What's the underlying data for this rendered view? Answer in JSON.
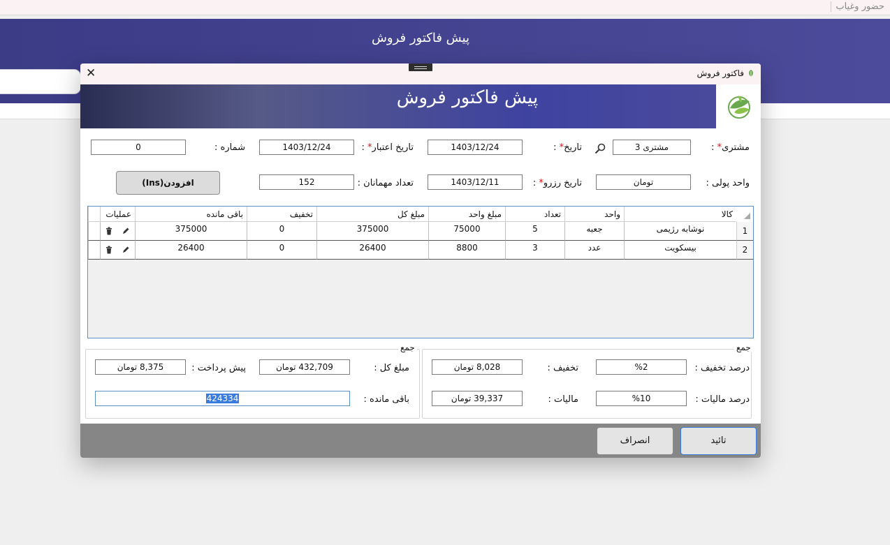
{
  "background": {
    "top_link": "حضور وغیاب",
    "header_title": "پیش فاکتور فروش"
  },
  "dialog": {
    "window_title": "فاکتور فروش",
    "close_glyph": "✕",
    "banner_title": "پیش فاکتور فروش",
    "form": {
      "customer_label": "مشتری",
      "customer_value": "مشتری 3",
      "date_label": "تاریخ",
      "date_value": "1403/12/24",
      "validity_label": "تاریخ اعتبار",
      "validity_value": "1403/12/24",
      "number_label": "شماره :",
      "number_value": "0",
      "currency_label": "واحد پولی :",
      "currency_value": "تومان",
      "reserve_label": "تاریخ رزرو",
      "reserve_value": "1403/12/11",
      "guests_label": "تعداد مهمانان :",
      "guests_value": "152",
      "required_mark": "*",
      "colon": " :",
      "add_button": "افزودن",
      "add_shortcut": "(Ins)"
    },
    "grid": {
      "headers": {
        "item": "کالا",
        "unit": "واحد",
        "qty": "تعداد",
        "unit_price": "مبلغ واحد",
        "total": "مبلغ کل",
        "discount": "تخفیف",
        "remaining": "باقی مانده",
        "actions": "عملیات"
      },
      "rows": [
        {
          "index": "1",
          "item": "نوشابه رژیمی",
          "unit": "جعبه",
          "qty": "5",
          "unit_price": "75000",
          "total": "375000",
          "discount": "0",
          "remaining": "375000"
        },
        {
          "index": "2",
          "item": "بیسکویت",
          "unit": "عدد",
          "qty": "3",
          "unit_price": "8800",
          "total": "26400",
          "discount": "0",
          "remaining": "26400"
        }
      ]
    },
    "summary_left": {
      "group_title": "جمع",
      "total_label": "مبلغ کل :",
      "total_value": "432,709 تومان",
      "prepay_label": "پیش پرداخت :",
      "prepay_value": "8,375 تومان",
      "remaining_label": "باقی مانده :",
      "remaining_value": "424334"
    },
    "summary_right": {
      "group_title": "جمع",
      "discount_pct_label": "درصد تخفیف :",
      "discount_pct_value": "%2",
      "discount_label": "تخفیف :",
      "discount_value": "8,028 تومان",
      "tax_pct_label": "درصد مالیات :",
      "tax_pct_value": "%10",
      "tax_label": "مالیات :",
      "tax_value": "39,337 تومان"
    },
    "footer": {
      "confirm": "تائید",
      "cancel": "انصراف"
    },
    "colors": {
      "banner": "#3f43a0",
      "header": "#4c4b9b",
      "required": "#e01010",
      "selection": "#3a7be0"
    }
  }
}
